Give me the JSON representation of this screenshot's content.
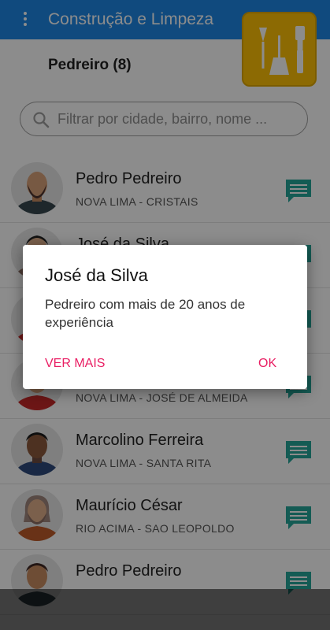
{
  "app_bar": {
    "title": "Construção e Limpeza"
  },
  "category": {
    "title": "Pedreiro (8)"
  },
  "search": {
    "placeholder": "Filtrar por cidade, bairro, nome ..."
  },
  "colors": {
    "app_bar": "#1e88e5",
    "accent": "#e91e63",
    "chat_icon": "#26a69a",
    "badge": "#ffc107"
  },
  "list": [
    {
      "name": "Pedro Pedreiro",
      "location": "NOVA LIMA - CRISTAIS"
    },
    {
      "name": "José da Silva",
      "location": ""
    },
    {
      "name": "",
      "location": ""
    },
    {
      "name": "",
      "location": "NOVA LIMA - JOSÉ DE ALMEIDA"
    },
    {
      "name": "Marcolino Ferreira",
      "location": "NOVA LIMA - SANTA RITA"
    },
    {
      "name": "Maurício César",
      "location": "RIO ACIMA - SAO LEOPOLDO"
    },
    {
      "name": "Pedro Pedreiro",
      "location": ""
    }
  ],
  "dialog": {
    "title": "José da Silva",
    "message": "Pedreiro com mais de 20 anos de experiência",
    "more_label": "VER MAIS",
    "ok_label": "OK"
  }
}
